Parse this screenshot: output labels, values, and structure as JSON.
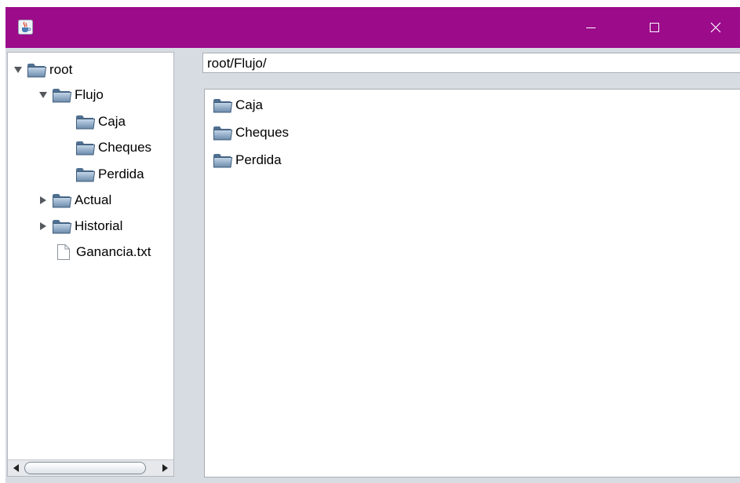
{
  "window": {
    "title_bar_color": "#9b0b8a",
    "app_icon": "java-cup-icon",
    "controls": [
      "minimize-icon",
      "maximize-icon",
      "close-icon"
    ]
  },
  "tree": {
    "nodes": [
      {
        "label": "root",
        "type": "folder",
        "expanded": true
      },
      {
        "label": "Flujo",
        "type": "folder",
        "expanded": true
      },
      {
        "label": "Caja",
        "type": "folder"
      },
      {
        "label": "Cheques",
        "type": "folder"
      },
      {
        "label": "Perdida",
        "type": "folder"
      },
      {
        "label": "Actual",
        "type": "folder",
        "expanded": false
      },
      {
        "label": "Historial",
        "type": "folder",
        "expanded": false
      },
      {
        "label": "Ganancia.txt",
        "type": "file"
      }
    ]
  },
  "path_field": {
    "value": "root/Flujo/"
  },
  "file_list": {
    "items": [
      {
        "label": "Caja",
        "type": "folder"
      },
      {
        "label": "Cheques",
        "type": "folder"
      },
      {
        "label": "Perdida",
        "type": "folder"
      }
    ]
  }
}
